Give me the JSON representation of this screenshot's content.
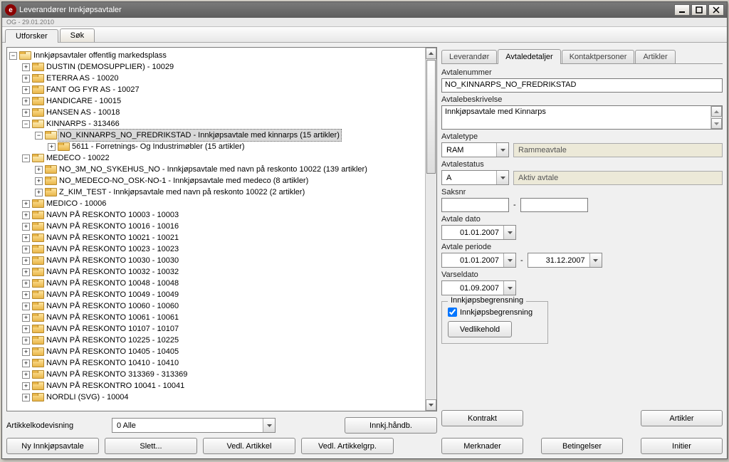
{
  "window": {
    "title": "Leverandører Innkjøpsavtaler",
    "subtitle": "OG - 29.01.2010"
  },
  "topTabs": {
    "explorer": "Utforsker",
    "search": "Søk"
  },
  "tree": {
    "root": "Innkjøpsavtaler offentlig markedsplass",
    "items": [
      {
        "label": "DUSTIN (DEMOSUPPLIER) - 10029"
      },
      {
        "label": "ETERRA AS - 10020"
      },
      {
        "label": "FANT OG FYR AS - 10027"
      },
      {
        "label": "HANDICARE - 10015"
      },
      {
        "label": "HANSEN AS - 10018"
      },
      {
        "label": "KINNARPS - 313466",
        "expanded": true,
        "children": [
          {
            "label": "NO_KINNARPS_NO_FREDRIKSTAD - Innkjøpsavtale med kinnarps (15 artikler)",
            "selected": true,
            "expanded": true,
            "children": [
              {
                "label": "5611 - Forretnings- Og Industrimøbler (15 artikler)"
              }
            ]
          }
        ]
      },
      {
        "label": "MEDECO - 10022",
        "expanded": true,
        "children": [
          {
            "label": "NO_3M_NO_SYKEHUS_NO - Innkjøpsavtale med navn på reskonto 10022 (139 artikler)"
          },
          {
            "label": "NO_MEDECO-NO_OSK-NO-1 - Innkjøpsavtale med medeco (8 artikler)"
          },
          {
            "label": "Z_KIM_TEST - Innkjøpsavtale med navn på reskonto 10022 (2 artikler)"
          }
        ]
      },
      {
        "label": "MEDICO - 10006"
      },
      {
        "label": "NAVN PÅ RESKONTO 10003 - 10003"
      },
      {
        "label": "NAVN PÅ RESKONTO 10016 - 10016"
      },
      {
        "label": "NAVN PÅ RESKONTO 10021 - 10021"
      },
      {
        "label": "NAVN PÅ RESKONTO 10023 - 10023"
      },
      {
        "label": "NAVN PÅ RESKONTO 10030 - 10030"
      },
      {
        "label": "NAVN PÅ RESKONTO 10032 - 10032"
      },
      {
        "label": "NAVN PÅ RESKONTO 10048 - 10048"
      },
      {
        "label": "NAVN PÅ RESKONTO 10049 - 10049"
      },
      {
        "label": "NAVN PÅ RESKONTO 10060 - 10060"
      },
      {
        "label": "NAVN PÅ RESKONTO 10061 - 10061"
      },
      {
        "label": "NAVN PÅ RESKONTO 10107 - 10107"
      },
      {
        "label": "NAVN PÅ RESKONTO 10225 - 10225"
      },
      {
        "label": "NAVN PÅ RESKONTO 10405 - 10405"
      },
      {
        "label": "NAVN PÅ RESKONTO 10410 - 10410"
      },
      {
        "label": "NAVN PÅ RESKONTO 313369 - 313369"
      },
      {
        "label": "NAVN PÅ RESKONTRO 10041 - 10041"
      },
      {
        "label": "NORDLI (SVG) - 10004"
      }
    ]
  },
  "leftBottom": {
    "artikkelkodevisning_label": "Artikkelkodevisning",
    "artikkelkodevisning_value": "0 Alle",
    "innkj_handb": "Innkj.håndb.",
    "ny_innkjopsavtale": "Ny Innkjøpsavtale",
    "slett": "Slett...",
    "vedl_artikkel": "Vedl. Artikkel",
    "vedl_artikkelgrp": "Vedl. Artikkelgrp."
  },
  "detailTabs": {
    "leverandor": "Leverandør",
    "avtaledetaljer": "Avtaledetaljer",
    "kontaktpersoner": "Kontaktpersoner",
    "artikler": "Artikler"
  },
  "details": {
    "avtalenummer_label": "Avtalenummer",
    "avtalenummer_value": "NO_KINNARPS_NO_FREDRIKSTAD",
    "avtalebeskrivelse_label": "Avtalebeskrivelse",
    "avtalebeskrivelse_value": "Innkjøpsavtale med Kinnarps",
    "avtaletype_label": "Avtaletype",
    "avtaletype_value": "RAM",
    "avtaletype_desc": "Rammeavtale",
    "avtalestatus_label": "Avtalestatus",
    "avtalestatus_value": "A",
    "avtalestatus_desc": "Aktiv avtale",
    "saksnr_label": "Saksnr",
    "saksnr_from": "",
    "saksnr_to": "",
    "avtale_dato_label": "Avtale dato",
    "avtale_dato_value": "01.01.2007",
    "avtale_periode_label": "Avtale periode",
    "avtale_periode_from": "01.01.2007",
    "avtale_periode_to": "31.12.2007",
    "varseldato_label": "Varseldato",
    "varseldato_value": "01.09.2007",
    "innkjopsbegrensning_title": "Innkjøpsbegrensning",
    "innkjopsbegrensning_check": "Innkjøpsbegrensning",
    "vedlikehold": "Vedlikehold"
  },
  "rightBottom": {
    "kontrakt": "Kontrakt",
    "artikler": "Artikler",
    "merknader": "Merknader",
    "betingelser": "Betingelser",
    "initier": "Initier"
  }
}
